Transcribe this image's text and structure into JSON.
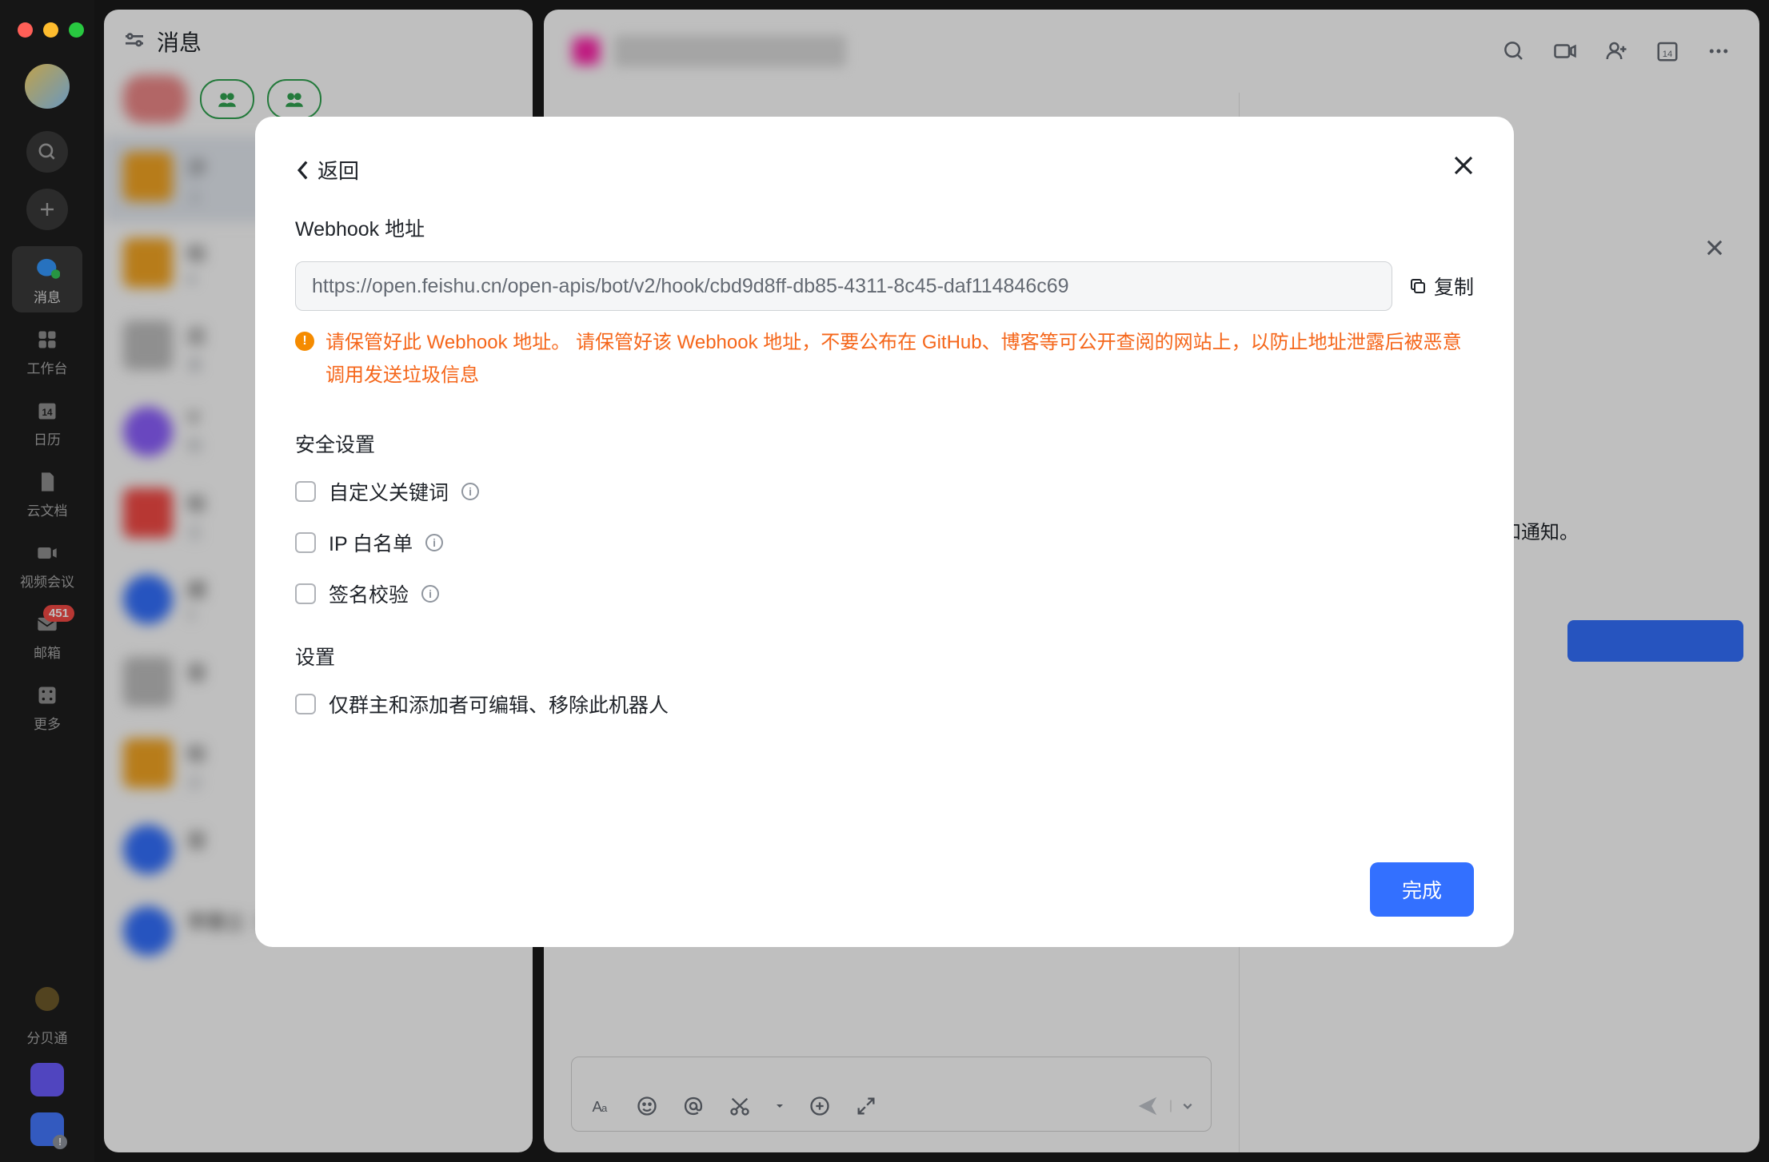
{
  "sidebar": {
    "items": [
      {
        "label": "消息",
        "icon": "chat-icon"
      },
      {
        "label": "工作台",
        "icon": "grid-icon"
      },
      {
        "label": "日历",
        "icon": "calendar-icon"
      },
      {
        "label": "云文档",
        "icon": "doc-icon"
      },
      {
        "label": "视频会议",
        "icon": "video-icon"
      },
      {
        "label": "邮箱",
        "icon": "mail-icon",
        "badge": "451"
      },
      {
        "label": "更多",
        "icon": "more-icon"
      }
    ],
    "app_label": "分贝通"
  },
  "chat_list": {
    "title": "消息"
  },
  "main": {
    "preview_text": "的消息和通知。"
  },
  "modal": {
    "back_label": "返回",
    "webhook_title": "Webhook 地址",
    "webhook_url": "https://open.feishu.cn/open-apis/bot/v2/hook/cbd9d8ff-db85-4311-8c45-daf114846c69",
    "copy_label": "复制",
    "warning_text": "请保管好此 Webhook 地址。 请保管好该 Webhook 地址，不要公布在 GitHub、博客等可公开查阅的网站上，以防止地址泄露后被恶意调用发送垃圾信息",
    "security_title": "安全设置",
    "security_options": [
      {
        "label": "自定义关键词"
      },
      {
        "label": "IP 白名单"
      },
      {
        "label": "签名校验"
      }
    ],
    "settings_title": "设置",
    "settings_options": [
      {
        "label": "仅群主和添加者可编辑、移除此机器人"
      }
    ],
    "finish_label": "完成"
  }
}
